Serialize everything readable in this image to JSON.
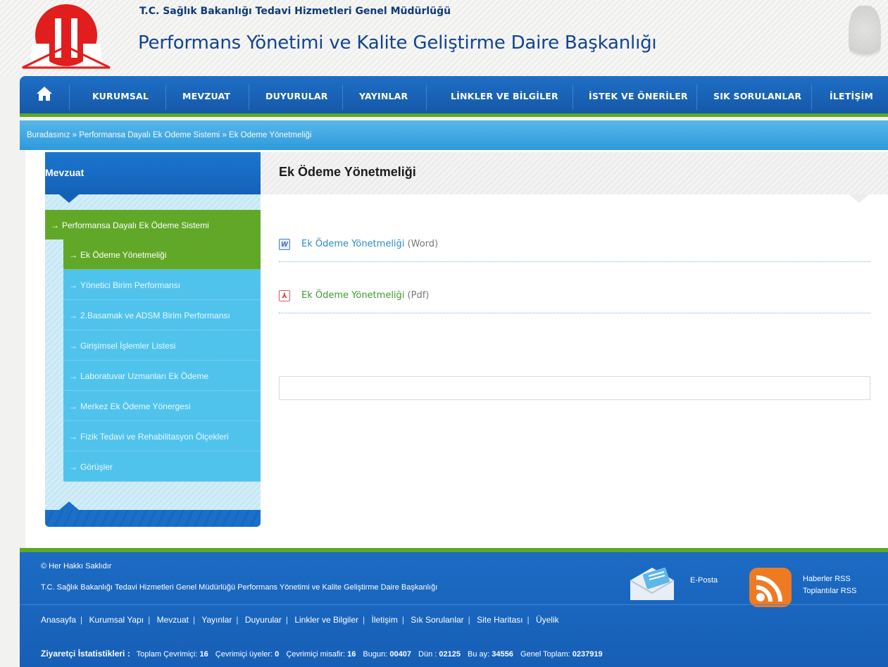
{
  "header": {
    "subtitle": "T.C. Sağlık Bakanlığı Tedavi Hizmetleri Genel Müdürlüğü",
    "title": "Performans Yönetimi ve Kalite Geliştirme Daire Başkanlığı"
  },
  "nav": {
    "home_icon": "home-icon",
    "items": [
      "KURUMSAL",
      "MEVZUAT",
      "DUYURULAR",
      "YAYINLAR",
      "LİNKLER VE BİLGİLER",
      "İSTEK VE ÖNERİLER",
      "SIK SORULANLAR",
      "İLETİŞİM"
    ]
  },
  "breadcrumb": {
    "prefix": "Buradasınız",
    "sep": "»",
    "items": [
      "Performansa Dayalı Ek Ödeme Sistemi",
      "Ek Ödeme Yönetmeliği"
    ]
  },
  "sidebar": {
    "title": "Mevzuat",
    "parent": "Performansa Dayalı Ek Ödeme Sistemi",
    "items": [
      "Ek Ödeme Yönetmeliği",
      "Yönetici Birim Performansı",
      "2.Basamak ve ADSM Birim Performansı",
      "Girişimsel İşlemler Listesi",
      "Laboratuvar Uzmanları Ek Ödeme",
      "Merkez Ek Ödeme Yönergesi",
      "Fizik Tedavi ve Rehabilitasyon Ölçekleri",
      "Görüşler"
    ],
    "active_index": 0
  },
  "main": {
    "title": "Ek Ödeme Yönetmeliği",
    "documents": [
      {
        "label": "Ek Ödeme Yönetmeliği",
        "type": "(Word)",
        "icon": "word-doc-icon",
        "color": "#2a8ac9"
      },
      {
        "label": "Ek Ödeme Yönetmeliği",
        "type": "(Pdf)",
        "icon": "pdf-icon",
        "color": "#3d9b2c"
      }
    ]
  },
  "footer": {
    "copyright": "© Her Hakkı Saklıdır",
    "org": "T.C. Sağlık Bakanlığı Tedavi Hizmetleri Genel Müdürlüğü Performans Yönetimi ve Kalite Geliştirme Daire Başkanlığı",
    "mail_label": "E-Posta",
    "rss_news": "Haberler RSS",
    "rss_meetings": "Toplantılar RSS",
    "links": [
      "Anasayfa",
      "Kurumsal Yapı",
      "Mevzuat",
      "Yayınlar",
      "Duyurular",
      "Linkler ve Bilgiler",
      "İletişim",
      "Sık Sorulanlar",
      "Site Haritası",
      "Üyelik"
    ],
    "stats": {
      "label": "Ziyaretçi İstatistikleri :",
      "online_label": "Toplam Çevrimiçi:",
      "online": "16",
      "members_label": "Çevrimiçi üyeler:",
      "members": "0",
      "guests_label": "Çevrimiçi misafir:",
      "guests": "16",
      "today_label": "Bugun:",
      "today": "00407",
      "yesterday_label": "Dün :",
      "yesterday": "02125",
      "month_label": "Bu ay:",
      "month": "34556",
      "total_label": "Genel Toplam:",
      "total": "0237919"
    }
  },
  "colors": {
    "nav_blue": "#1658a8",
    "accent_green": "#5da824",
    "sidebar_item": "#50c3ed",
    "breadcrumb": "#2e9adb"
  }
}
